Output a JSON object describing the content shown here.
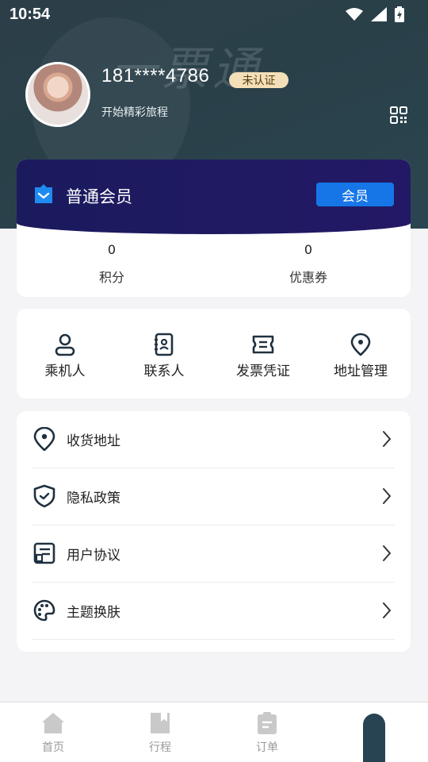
{
  "status_bar": {
    "time": "10:54"
  },
  "header": {
    "brand_watermark": "一票通",
    "phone": "181****4786",
    "verify_badge": "未认证",
    "tagline": "开始精彩旅程"
  },
  "member": {
    "title": "普通会员",
    "button": "会员",
    "stats": [
      {
        "value": "0",
        "label": "积分"
      },
      {
        "value": "0",
        "label": "优惠券"
      }
    ]
  },
  "quick_actions": [
    {
      "label": "乘机人",
      "icon": "person-icon"
    },
    {
      "label": "联系人",
      "icon": "contacts-icon"
    },
    {
      "label": "发票凭证",
      "icon": "ticket-icon"
    },
    {
      "label": "地址管理",
      "icon": "location-icon"
    }
  ],
  "menu": [
    {
      "label": "收货地址",
      "icon": "location-pin-icon"
    },
    {
      "label": "隐私政策",
      "icon": "shield-check-icon"
    },
    {
      "label": "用户协议",
      "icon": "document-icon"
    },
    {
      "label": "主题换肤",
      "icon": "palette-icon"
    }
  ],
  "tabbar": [
    {
      "label": "首页",
      "icon": "home-icon"
    },
    {
      "label": "行程",
      "icon": "bookmark-icon"
    },
    {
      "label": "订单",
      "icon": "clipboard-icon"
    }
  ],
  "colors": {
    "header_bg": "#2b4049",
    "member_bg": "#1c1a5f",
    "accent_blue": "#1676e8",
    "badge_bg": "#f3dfb8",
    "icon_dark": "#1f3140"
  }
}
